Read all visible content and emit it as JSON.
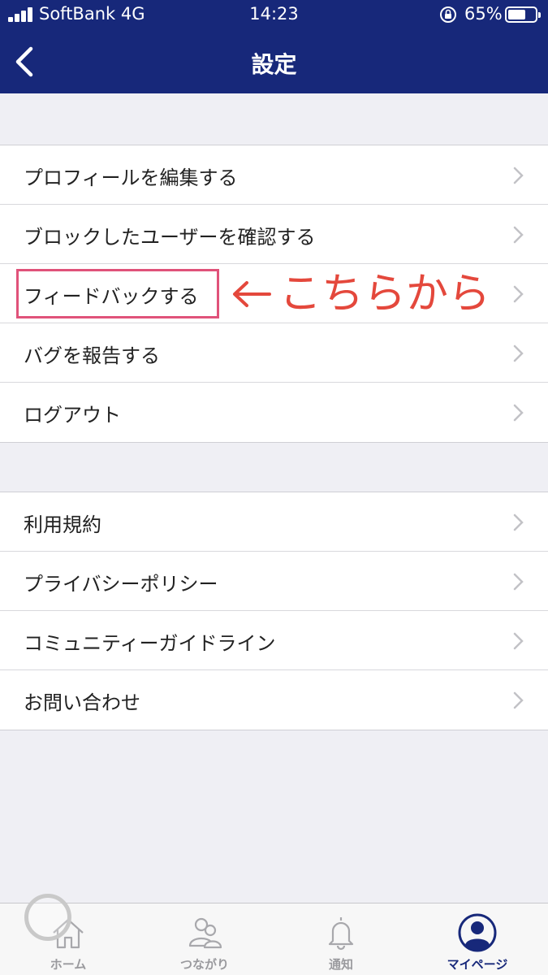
{
  "status_bar": {
    "carrier": "SoftBank 4G",
    "time": "14:23",
    "battery_percent": "65%",
    "battery_level": 0.65
  },
  "nav": {
    "back_icon": "chevron-left-icon",
    "title": "設定"
  },
  "settings_group_1": [
    {
      "label": "プロフィールを編集する"
    },
    {
      "label": "ブロックしたユーザーを確認する"
    },
    {
      "label": "フィードバックする"
    },
    {
      "label": "バグを報告する"
    },
    {
      "label": "ログアウト"
    }
  ],
  "settings_group_2": [
    {
      "label": "利用規約"
    },
    {
      "label": "プライバシーポリシー"
    },
    {
      "label": "コミュニティーガイドライン"
    },
    {
      "label": "お問い合わせ"
    }
  ],
  "annotation": {
    "text": "こちらから",
    "arrow_icon": "left-arrow-icon",
    "color": "#e4483c",
    "box_color": "#e0527a"
  },
  "tab_bar": {
    "tabs": [
      {
        "label": "ホーム",
        "icon": "home-icon",
        "active": false
      },
      {
        "label": "つながり",
        "icon": "people-icon",
        "active": false
      },
      {
        "label": "通知",
        "icon": "bell-icon",
        "active": false
      },
      {
        "label": "マイページ",
        "icon": "user-icon",
        "active": true
      }
    ]
  },
  "colors": {
    "header": "#17287a",
    "background": "#efeff4",
    "active_tab": "#17287a",
    "inactive_tab": "#9a9a9e"
  }
}
